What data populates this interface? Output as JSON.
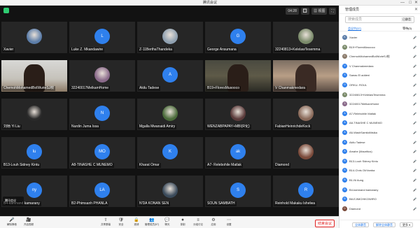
{
  "window": {
    "title": "腾讯会议",
    "controls": [
      "—",
      "□",
      "✕"
    ]
  },
  "topbar": {
    "timer": "04:28",
    "speaker_view": "🔳",
    "grid_view": "▦ 视图",
    "fullscreen": "⛶"
  },
  "tiles": [
    {
      "name": "Xavier",
      "kind": "photo",
      "color": "#5c7da8"
    },
    {
      "name": "Luke Z. Mkandawire",
      "kind": "letter",
      "letter": "L",
      "color": "#2f80ed"
    },
    {
      "name": "Z-11BerthaThandeka",
      "kind": "photo",
      "color": "#8fa0b0"
    },
    {
      "name": "George Ansumana",
      "kind": "letter",
      "letter": "G",
      "color": "#2f80ed"
    },
    {
      "name": "32240813+KelelawTesemma",
      "kind": "photo",
      "color": "#7a8a6a"
    },
    {
      "name": "ChemohMohamedBolWurieSJ校",
      "kind": "video",
      "scene": "s1"
    },
    {
      "name": "32240017MelkamHome",
      "kind": "photo",
      "color": "#8a6a8a"
    },
    {
      "name": "Akilu Tadese",
      "kind": "letter",
      "letter": "A",
      "color": "#2f80ed"
    },
    {
      "name": "B19+FloresMusooco",
      "kind": "video",
      "scene": "s2"
    },
    {
      "name": "V Chanmakmedara",
      "kind": "video",
      "scene": "s3"
    },
    {
      "name": "刘杨 Yi Liu",
      "kind": "photo",
      "color": "#2a2a2a"
    },
    {
      "name": "Nurdin Juma Issa",
      "kind": "letter",
      "letter": "N",
      "color": "#2f80ed"
    },
    {
      "name": "Mgalla Mwanaidi Amiry",
      "kind": "photo",
      "color": "#4a6a3a"
    },
    {
      "name": "WENZABPAPAY+MBI(R化)",
      "kind": "photo",
      "color": "#5a3a3a"
    },
    {
      "name": "FabianHeinrichdeKock",
      "kind": "photo",
      "color": "#8a6a5a"
    },
    {
      "name": "B13-Louh Sidney Kintu",
      "kind": "letter",
      "letter": "lu",
      "color": "#2f80ed"
    },
    {
      "name": "A8-TINASHE C MUNEMO",
      "kind": "letter",
      "letter": "MO",
      "color": "#2f80ed"
    },
    {
      "name": "Kharat Omar",
      "kind": "letter",
      "letter": "K",
      "color": "#2f80ed"
    },
    {
      "name": "A7- Relebohile Matlak",
      "kind": "letter",
      "letter": "ak",
      "color": "#2f80ed"
    },
    {
      "name": "Diamond",
      "kind": "photo",
      "color": "#7a4a3a"
    },
    {
      "name": "B4-kamnand kamarany",
      "kind": "letter",
      "letter": "ny",
      "color": "#2f80ed"
    },
    {
      "name": "B2-Phimsanh PHANLA",
      "kind": "letter",
      "letter": "LA",
      "color": "#2f80ed"
    },
    {
      "name": "N'DA KONAN SEN",
      "kind": "photo",
      "color": "#3a4a5a"
    },
    {
      "name": "SOUN SAMBATH",
      "kind": "letter",
      "letter": "S",
      "color": "#2f80ed"
    },
    {
      "name": "Reinhold Makaku Ishelwa",
      "kind": "letter",
      "letter": "R",
      "color": "#2f80ed"
    }
  ],
  "float_label": "腾讯会议",
  "toolbar": {
    "items": [
      {
        "icon": "🎤",
        "label": "解除静音"
      },
      {
        "icon": "🎥",
        "label": "开启视频"
      },
      {
        "icon": "⇧",
        "label": "共享屏幕"
      },
      {
        "icon": "🛡",
        "label": "安全"
      },
      {
        "icon": "🔒",
        "label": "邀请"
      },
      {
        "icon": "👥",
        "label": "管理成员(57)"
      },
      {
        "icon": "💬",
        "label": "聊天"
      },
      {
        "icon": "⏺",
        "label": "录制"
      },
      {
        "icon": "≡",
        "label": "分组讨论"
      },
      {
        "icon": "⚙",
        "label": "应用"
      },
      {
        "icon": "⋯",
        "label": "设置"
      }
    ],
    "leave": "结束会议"
  },
  "sidebar": {
    "title": "管理成员",
    "close": "✕",
    "search_placeholder": "搜索成员",
    "search_btn": "已静音",
    "tabs": [
      "会议中(57)",
      "等待(0)"
    ],
    "participants": [
      {
        "letter": "K",
        "name": "Xavier",
        "color": "#5c7da8"
      },
      {
        "letter": "B",
        "name": "B19+FloresMusooco",
        "color": "#7a8a6a"
      },
      {
        "letter": "C",
        "name": "ChemohMohamedBolWurieSJ校",
        "color": "#8a7a6a"
      },
      {
        "letter": "V",
        "name": "V Chanmakmedara",
        "color": "#2f80ed"
      },
      {
        "letter": "S",
        "name": "Saeas El addeni",
        "color": "#2f80ed"
      },
      {
        "letter": "O",
        "name": "ORKU- ROUL",
        "color": "#2f80ed"
      },
      {
        "letter": "3",
        "name": "32240813+KelelawTesemma",
        "color": "#7a8a6a"
      },
      {
        "letter": "3",
        "name": "32240017MelkamHome",
        "color": "#8a6a8a"
      },
      {
        "letter": "A",
        "name": "A7-Relebohile Matlak",
        "color": "#2f80ed"
      },
      {
        "letter": "A",
        "name": "A8-TINASHE C MUNEMO",
        "color": "#2f80ed"
      },
      {
        "letter": "A",
        "name": "A6-WashSamitaNtsika",
        "color": "#2f80ed"
      },
      {
        "letter": "A",
        "name": "Akilu Tadese",
        "color": "#2f80ed"
      },
      {
        "letter": "A",
        "name": "Amahe (Mauritius)",
        "color": "#2f80ed"
      },
      {
        "letter": "B",
        "name": "B13-Louh Sidney Kintu",
        "color": "#2f80ed"
      },
      {
        "letter": "B",
        "name": "B14-Chris OkYamba",
        "color": "#2f80ed"
      },
      {
        "letter": "B",
        "name": "B1-Ni Aung",
        "color": "#2f80ed"
      },
      {
        "letter": "B",
        "name": "B4-kamnand kamarany",
        "color": "#2f80ed"
      },
      {
        "letter": "B",
        "name": "B8-EJIMCHIKOWIRO",
        "color": "#2f80ed"
      },
      {
        "letter": "D",
        "name": "Diamond",
        "color": "#7a4a3a"
      }
    ],
    "footer": [
      "全体静音",
      "解除全体静音",
      "更多 ▾"
    ]
  }
}
